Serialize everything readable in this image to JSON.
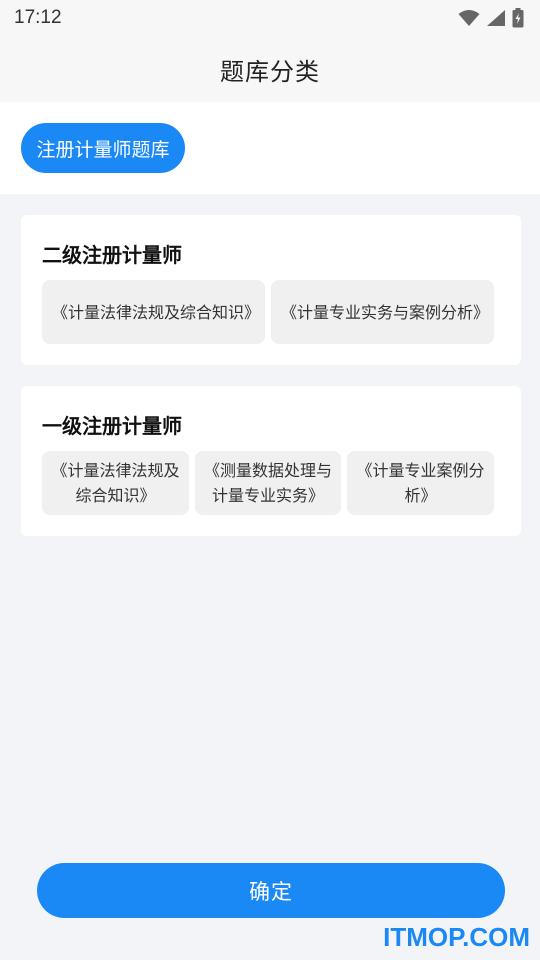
{
  "status_bar": {
    "time": "17:12"
  },
  "header": {
    "title": "题库分类"
  },
  "category": {
    "selected_label": "注册计量师题库"
  },
  "sections": [
    {
      "title": "二级注册计量师",
      "books": [
        "《计量法律法规及综合知识》",
        "《计量专业实务与案例分析》"
      ]
    },
    {
      "title": "一级注册计量师",
      "books": [
        "《计量法律法规及综合知识》",
        "《测量数据处理与计量专业实务》",
        "《计量专业案例分析》"
      ]
    }
  ],
  "footer": {
    "confirm_label": "确定"
  },
  "watermark": "ITMOP.COM",
  "colors": {
    "accent": "#1a89f5",
    "background": "#f2f4f7",
    "card": "#ffffff",
    "chip": "#f0f0f0"
  }
}
